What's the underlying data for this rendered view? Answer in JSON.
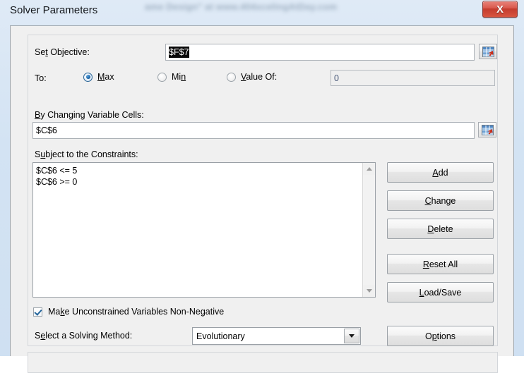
{
  "window": {
    "title": "Solver Parameters",
    "background_watermark": "ame Design\" at www.404xcelingAtDay.com",
    "close_label": "X",
    "accent_close_color": "#c33b2d"
  },
  "objective": {
    "label_pre": "Se",
    "label_accel": "t",
    "label_post": " Objective:",
    "value": "$F$7",
    "value_selected": true,
    "range_picker_name": "Set Objective range selector"
  },
  "to_row": {
    "label": "To:",
    "options": [
      {
        "pre": "",
        "accel": "M",
        "post": "ax",
        "selected": true
      },
      {
        "pre": "Mi",
        "accel": "n",
        "post": "",
        "selected": false
      },
      {
        "pre": "",
        "accel": "V",
        "post": "alue Of:",
        "selected": false
      }
    ],
    "value_of_input": "0",
    "value_of_enabled": false
  },
  "changing_cells": {
    "label_pre": "",
    "label_accel": "B",
    "label_post": "y Changing Variable Cells:",
    "value": "$C$6",
    "range_picker_name": "Changing cells range selector"
  },
  "constraints": {
    "label_pre": "S",
    "label_accel": "u",
    "label_post": "bject to the Constraints:",
    "items": [
      "$C$6 <= 5",
      "$C$6 >= 0"
    ],
    "scroll_up_icon": "triangle-up-icon",
    "scroll_down_icon": "triangle-down-icon"
  },
  "buttons": [
    {
      "name": "add-button",
      "pre": "",
      "accel": "A",
      "post": "dd"
    },
    {
      "name": "change-button",
      "pre": "",
      "accel": "C",
      "post": "hange"
    },
    {
      "name": "delete-button",
      "pre": "",
      "accel": "D",
      "post": "elete"
    },
    {
      "name": "reset-all-button",
      "pre": "",
      "accel": "R",
      "post": "eset All"
    },
    {
      "name": "load-save-button",
      "pre": "",
      "accel": "L",
      "post": "oad/Save"
    },
    {
      "name": "options-button",
      "pre": "O",
      "accel": "p",
      "post": "tions"
    }
  ],
  "nonnegative": {
    "checked": true,
    "label_pre": "Ma",
    "label_accel": "k",
    "label_post": "e Unconstrained Variables Non-Negative"
  },
  "solving_method": {
    "label_pre": "S",
    "label_accel": "e",
    "label_post": "lect a Solving Method:",
    "value": "Evolutionary",
    "dropdown_icon": "chevron-down-icon"
  }
}
